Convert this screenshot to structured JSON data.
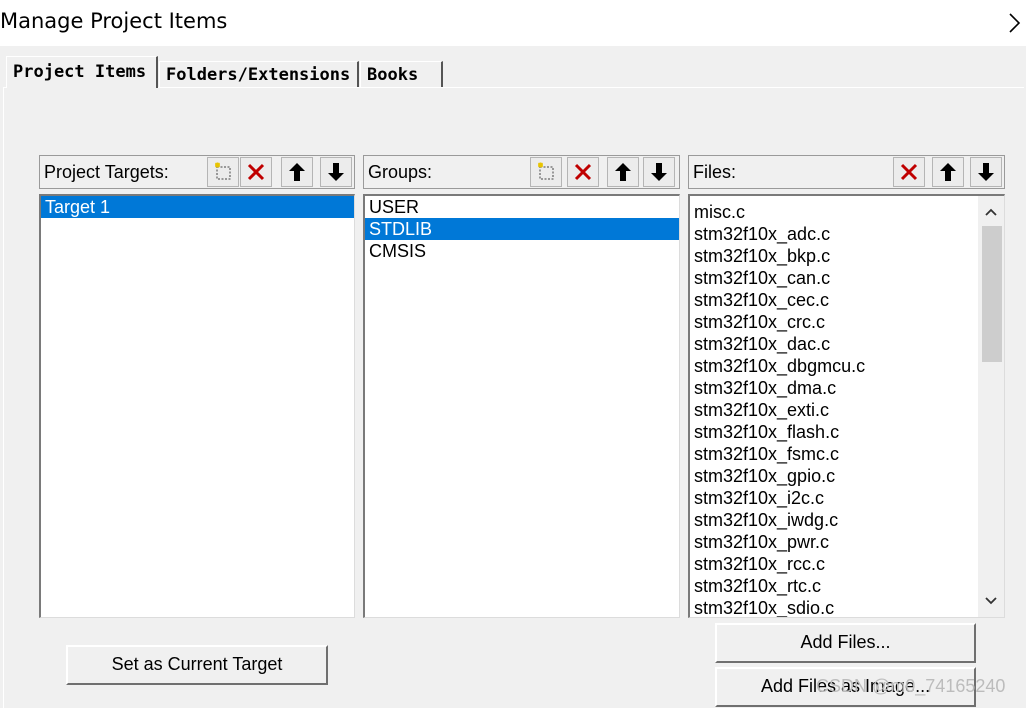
{
  "window": {
    "title": "Manage Project Items"
  },
  "tabs": [
    {
      "label": "Project Items"
    },
    {
      "label": "Folders/Extensions"
    },
    {
      "label": "Books"
    }
  ],
  "targets": {
    "header": "Project Targets:",
    "items": [
      "Target 1"
    ],
    "selected_index": 0
  },
  "groups": {
    "header": "Groups:",
    "items": [
      "USER",
      "STDLIB",
      "CMSIS"
    ],
    "selected_index": 1
  },
  "files": {
    "header": "Files:",
    "items": [
      "misc.c",
      "stm32f10x_adc.c",
      "stm32f10x_bkp.c",
      "stm32f10x_can.c",
      "stm32f10x_cec.c",
      "stm32f10x_crc.c",
      "stm32f10x_dac.c",
      "stm32f10x_dbgmcu.c",
      "stm32f10x_dma.c",
      "stm32f10x_exti.c",
      "stm32f10x_flash.c",
      "stm32f10x_fsmc.c",
      "stm32f10x_gpio.c",
      "stm32f10x_i2c.c",
      "stm32f10x_iwdg.c",
      "stm32f10x_pwr.c",
      "stm32f10x_rcc.c",
      "stm32f10x_rtc.c",
      "stm32f10x_sdio.c"
    ]
  },
  "buttons": {
    "set_current": "Set as Current Target",
    "add_files": "Add Files...",
    "add_files_image": "Add Files as Image..."
  },
  "watermark": "CSDN @m0_74165240",
  "colors": {
    "selection": "#0078d7",
    "delete_icon": "#c00000"
  }
}
